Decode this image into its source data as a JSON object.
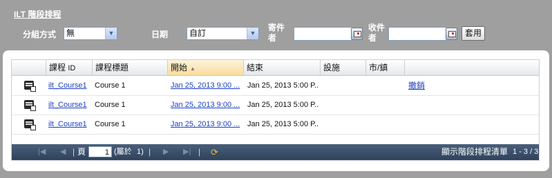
{
  "header": {
    "title": "ILT 階段排程"
  },
  "filters": {
    "group_by_label": "分組方式",
    "group_by_value": "無",
    "date_label": "日期",
    "date_value": "自訂",
    "from_label_line1": "寄件",
    "from_label_line2": "者",
    "from_value": "",
    "to_label_line1": "收件",
    "to_label_line2": "者",
    "to_value": "",
    "apply_label": "套用"
  },
  "table": {
    "columns": {
      "course_id": "課程",
      "course_id_suffix": "ID",
      "course_title": "課程標題",
      "start": "開始",
      "end": "結束",
      "facility": "設施",
      "city": "市/鎮"
    },
    "rows": [
      {
        "course_id": "ilt_Course1",
        "course_title": "Course 1",
        "start": "Jan 25, 2013 9:00 ...",
        "end": "Jan 25, 2013 5:00 P...",
        "facility": "",
        "city": "",
        "action": "撤銷"
      },
      {
        "course_id": "ilt_Course1",
        "course_title": "Course 1",
        "start": "Jan 25, 2013 9:00 ...",
        "end": "Jan 25, 2013 5:00 P...",
        "facility": "",
        "city": "",
        "action": ""
      },
      {
        "course_id": "ilt_Course1",
        "course_title": "Course 1",
        "start": "Jan 25, 2013 9:00 ...",
        "end": "Jan 25, 2013 5:00 P...",
        "facility": "",
        "city": "",
        "action": ""
      }
    ]
  },
  "pager": {
    "page_label": "頁",
    "page_value": "1",
    "of_label": "(屬於",
    "total_pages": "1)",
    "status_text": "顯示階段排程清單",
    "range_text": "1 - 3 / 3"
  }
}
